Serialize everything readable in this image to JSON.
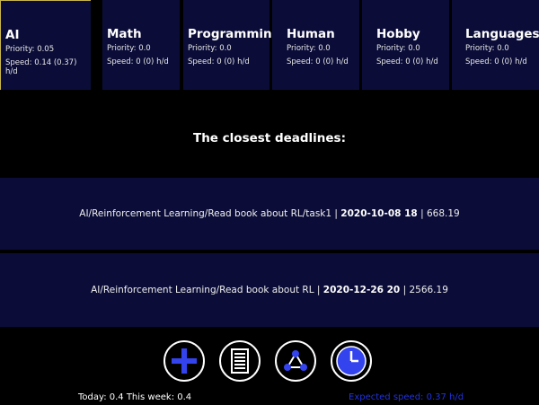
{
  "categories": [
    {
      "name": "AI",
      "priority": "Priority: 0.05",
      "speed": "Speed: 0.14 (0.37) h/d"
    },
    {
      "name": "Math",
      "priority": "Priority: 0.0",
      "speed": "Speed: 0 (0) h/d"
    },
    {
      "name": "Programming",
      "priority": "Priority: 0.0",
      "speed": "Speed: 0 (0) h/d"
    },
    {
      "name": "Human",
      "priority": "Priority: 0.0",
      "speed": "Speed: 0 (0) h/d"
    },
    {
      "name": "Hobby",
      "priority": "Priority: 0.0",
      "speed": "Speed: 0 (0) h/d"
    },
    {
      "name": "Languages",
      "priority": "Priority: 0.0",
      "speed": "Speed: 0 (0) h/d"
    }
  ],
  "deadlines": {
    "title": "The closest deadlines:",
    "items": [
      {
        "path": "AI/Reinforcement Learning/Read book about RL/task1",
        "date": "2020-10-08 18",
        "value": "668.19"
      },
      {
        "path": "AI/Reinforcement Learning/Read book about RL",
        "date": "2020-12-26 20",
        "value": "2566.19"
      }
    ]
  },
  "toolbar": {
    "icons": [
      "add-icon",
      "list-icon",
      "graph-icon",
      "clock-icon"
    ],
    "accent_color": "#3344ee"
  },
  "status": {
    "today": "Today: 0.4 This week: 0.4",
    "expected": "Expected speed: 0.37 h/d"
  },
  "colors": {
    "panel": "#0b0d38",
    "background": "#000000",
    "selected_border": "#c8b64a"
  }
}
